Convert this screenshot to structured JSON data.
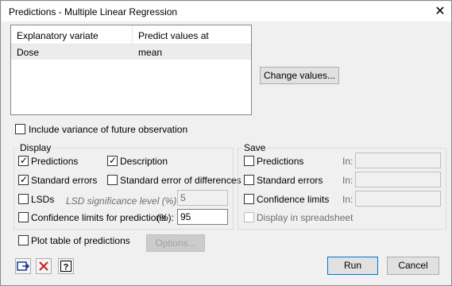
{
  "window": {
    "title": "Predictions - Multiple Linear Regression",
    "close_glyph": "✕"
  },
  "list": {
    "headers": [
      "Explanatory variate",
      "Predict values at"
    ],
    "rows": [
      {
        "variate": "Dose",
        "value": "mean"
      }
    ]
  },
  "change_values_label": "Change values...",
  "include_variance_label": "Include variance of future observation",
  "display": {
    "label": "Display",
    "predictions": "Predictions",
    "description": "Description",
    "standard_errors": "Standard errors",
    "std_err_diff": "Standard error of differences",
    "lsds": "LSDs",
    "lsd_level_label": "LSD significance level (%):",
    "lsd_level_value": "5",
    "conf_limits": "Confidence limits for predictions",
    "conf_pct_label": "(%):",
    "conf_pct_value": "95",
    "checked": {
      "predictions": true,
      "description": true,
      "standard_errors": true,
      "std_err_diff": false,
      "lsds": false,
      "conf_limits": false
    }
  },
  "save": {
    "label": "Save",
    "predictions": "Predictions",
    "standard_errors": "Standard errors",
    "confidence_limits": "Confidence limits",
    "in_label": "In:",
    "display_in_spreadsheet": "Display in spreadsheet"
  },
  "plot_table_label": "Plot table of predictions",
  "options_label": "Options...",
  "run_label": "Run",
  "cancel_label": "Cancel",
  "icons": [
    "pin-icon",
    "clear-icon",
    "help-icon"
  ]
}
